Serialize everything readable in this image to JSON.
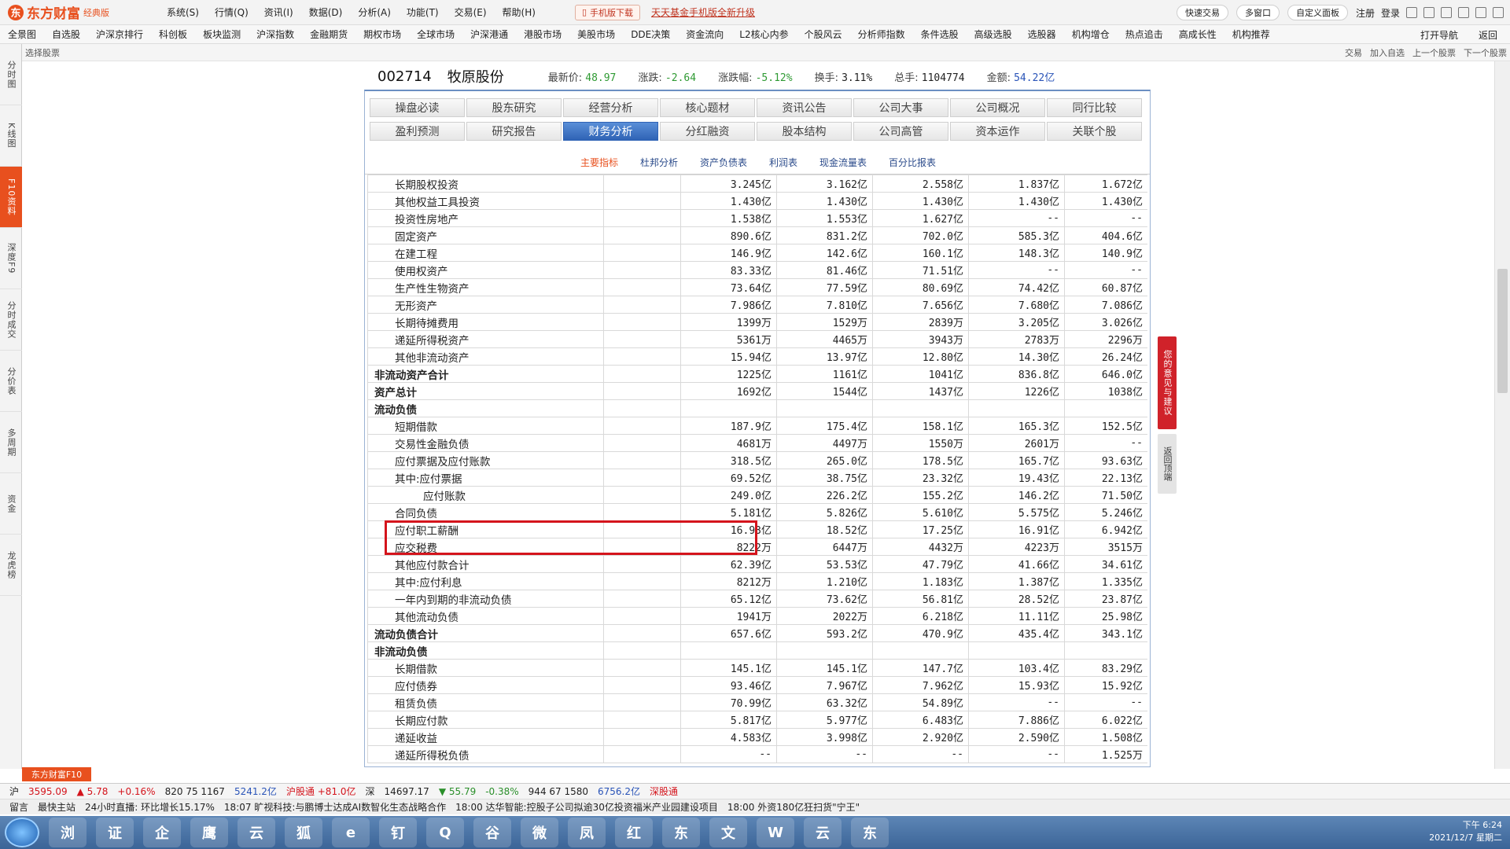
{
  "app": {
    "logo_mark": "东",
    "name": "东方财富",
    "edition": "经典版"
  },
  "menus": [
    "系统(S)",
    "行情(Q)",
    "资讯(I)",
    "数据(D)",
    "分析(A)",
    "功能(T)",
    "交易(E)",
    "帮助(H)"
  ],
  "download_button": "手机版下载",
  "promo_text": "天天基金手机版全新升级",
  "top_tools": {
    "quick_trade": "快速交易",
    "multi_window": "多窗口",
    "custom_panel": "自定义面板",
    "register": "注册",
    "login": "登录"
  },
  "nav_items": [
    "全景图",
    "自选股",
    "沪深京排行",
    "科创板",
    "板块监测",
    "沪深指数",
    "金融期货",
    "期权市场",
    "全球市场",
    "沪深港通",
    "港股市场",
    "美股市场",
    "DDE决策",
    "资金流向",
    "L2核心内参",
    "个股风云",
    "分析师指数",
    "条件选股",
    "高级选股",
    "选股器",
    "机构增仓",
    "热点追击",
    "高成长性",
    "机构推荐"
  ],
  "nav_right": [
    "打开导航",
    "返回"
  ],
  "subbar": {
    "select_stock": "选择股票",
    "actions": [
      "交易",
      "加入自选",
      "上一个股票",
      "下一个股票"
    ]
  },
  "sidebar": [
    {
      "label": "分时图",
      "active": false
    },
    {
      "label": "K线图",
      "active": false
    },
    {
      "label": "F10资料",
      "active": true
    },
    {
      "label": "深度F9",
      "active": false
    },
    {
      "label": "分时成交",
      "active": false
    },
    {
      "label": "分价表",
      "active": false
    },
    {
      "label": "多周期",
      "active": false
    },
    {
      "label": "资金",
      "active": false
    },
    {
      "label": "龙虎榜",
      "active": false
    }
  ],
  "stock": {
    "code": "002714",
    "name": "牧原股份",
    "latest_label": "最新价:",
    "latest": "48.97",
    "change_label": "涨跌:",
    "change": "-2.64",
    "change_pct_label": "涨跌幅:",
    "change_pct": "-5.12%",
    "turnover_label": "换手:",
    "turnover": "3.11%",
    "volume_label": "总手:",
    "volume": "1104774",
    "amount_label": "金额:",
    "amount": "54.22亿"
  },
  "tabs_row1": [
    {
      "label": "操盘必读",
      "active": false
    },
    {
      "label": "股东研究",
      "active": false
    },
    {
      "label": "经营分析",
      "active": false
    },
    {
      "label": "核心题材",
      "active": false
    },
    {
      "label": "资讯公告",
      "active": false
    },
    {
      "label": "公司大事",
      "active": false
    },
    {
      "label": "公司概况",
      "active": false
    },
    {
      "label": "同行比较",
      "active": false
    }
  ],
  "tabs_row2": [
    {
      "label": "盈利预测",
      "active": false
    },
    {
      "label": "研究报告",
      "active": false
    },
    {
      "label": "财务分析",
      "active": true
    },
    {
      "label": "分红融资",
      "active": false
    },
    {
      "label": "股本结构",
      "active": false
    },
    {
      "label": "公司高管",
      "active": false
    },
    {
      "label": "资本运作",
      "active": false
    },
    {
      "label": "关联个股",
      "active": false
    }
  ],
  "subtabs": [
    {
      "label": "主要指标",
      "active": true
    },
    {
      "label": "杜邦分析",
      "active": false
    },
    {
      "label": "资产负债表",
      "active": false
    },
    {
      "label": "利润表",
      "active": false
    },
    {
      "label": "现金流量表",
      "active": false
    },
    {
      "label": "百分比报表",
      "active": false
    }
  ],
  "balance_rows": [
    {
      "label": "长期股权投资",
      "style": "",
      "values": [
        "3.245亿",
        "3.162亿",
        "2.558亿",
        "1.837亿",
        "1.672亿"
      ]
    },
    {
      "label": "其他权益工具投资",
      "style": "",
      "values": [
        "1.430亿",
        "1.430亿",
        "1.430亿",
        "1.430亿",
        "1.430亿"
      ]
    },
    {
      "label": "投资性房地产",
      "style": "",
      "values": [
        "1.538亿",
        "1.553亿",
        "1.627亿",
        "--",
        "--"
      ]
    },
    {
      "label": "固定资产",
      "style": "",
      "values": [
        "890.6亿",
        "831.2亿",
        "702.0亿",
        "585.3亿",
        "404.6亿"
      ]
    },
    {
      "label": "在建工程",
      "style": "",
      "values": [
        "146.9亿",
        "142.6亿",
        "160.1亿",
        "148.3亿",
        "140.9亿"
      ]
    },
    {
      "label": "使用权资产",
      "style": "",
      "values": [
        "83.33亿",
        "81.46亿",
        "71.51亿",
        "--",
        "--"
      ]
    },
    {
      "label": "生产性生物资产",
      "style": "",
      "values": [
        "73.64亿",
        "77.59亿",
        "80.69亿",
        "74.42亿",
        "60.87亿"
      ]
    },
    {
      "label": "无形资产",
      "style": "",
      "values": [
        "7.986亿",
        "7.810亿",
        "7.656亿",
        "7.680亿",
        "7.086亿"
      ]
    },
    {
      "label": "长期待摊费用",
      "style": "",
      "values": [
        "1399万",
        "1529万",
        "2839万",
        "3.205亿",
        "3.026亿"
      ]
    },
    {
      "label": "递延所得税资产",
      "style": "",
      "values": [
        "5361万",
        "4465万",
        "3943万",
        "2783万",
        "2296万"
      ]
    },
    {
      "label": "其他非流动资产",
      "style": "",
      "values": [
        "15.94亿",
        "13.97亿",
        "12.80亿",
        "14.30亿",
        "26.24亿"
      ]
    },
    {
      "label": "非流动资产合计",
      "style": "bold",
      "values": [
        "1225亿",
        "1161亿",
        "1041亿",
        "836.8亿",
        "646.0亿"
      ]
    },
    {
      "label": "资产总计",
      "style": "bold",
      "values": [
        "1692亿",
        "1544亿",
        "1437亿",
        "1226亿",
        "1038亿"
      ]
    },
    {
      "label": "流动负债",
      "style": "bold",
      "values": [
        "",
        "",
        "",
        "",
        ""
      ]
    },
    {
      "label": "短期借款",
      "style": "",
      "values": [
        "187.9亿",
        "175.4亿",
        "158.1亿",
        "165.3亿",
        "152.5亿"
      ]
    },
    {
      "label": "交易性金融负债",
      "style": "",
      "values": [
        "4681万",
        "4497万",
        "1550万",
        "2601万",
        "--"
      ]
    },
    {
      "label": "应付票据及应付账款",
      "style": "",
      "values": [
        "318.5亿",
        "265.0亿",
        "178.5亿",
        "165.7亿",
        "93.63亿"
      ]
    },
    {
      "label": "其中:应付票据",
      "style": "",
      "values": [
        "69.52亿",
        "38.75亿",
        "23.32亿",
        "19.43亿",
        "22.13亿"
      ]
    },
    {
      "label": "应付账款",
      "style": "sub",
      "values": [
        "249.0亿",
        "226.2亿",
        "155.2亿",
        "146.2亿",
        "71.50亿"
      ]
    },
    {
      "label": "合同负债",
      "style": "",
      "values": [
        "5.181亿",
        "5.826亿",
        "5.610亿",
        "5.575亿",
        "5.246亿"
      ]
    },
    {
      "label": "应付职工薪酬",
      "style": "",
      "values": [
        "16.93亿",
        "18.52亿",
        "17.25亿",
        "16.91亿",
        "6.942亿"
      ]
    },
    {
      "label": "应交税费",
      "style": "",
      "values": [
        "8222万",
        "6447万",
        "4432万",
        "4223万",
        "3515万"
      ]
    },
    {
      "label": "其他应付款合计",
      "style": "",
      "values": [
        "62.39亿",
        "53.53亿",
        "47.79亿",
        "41.66亿",
        "34.61亿"
      ]
    },
    {
      "label": "其中:应付利息",
      "style": "",
      "values": [
        "8212万",
        "1.210亿",
        "1.183亿",
        "1.387亿",
        "1.335亿"
      ]
    },
    {
      "label": "一年内到期的非流动负债",
      "style": "",
      "values": [
        "65.12亿",
        "73.62亿",
        "56.81亿",
        "28.52亿",
        "23.87亿"
      ]
    },
    {
      "label": "其他流动负债",
      "style": "",
      "values": [
        "1941万",
        "2022万",
        "6.218亿",
        "11.11亿",
        "25.98亿"
      ]
    },
    {
      "label": "流动负债合计",
      "style": "bold",
      "values": [
        "657.6亿",
        "593.2亿",
        "470.9亿",
        "435.4亿",
        "343.1亿"
      ]
    },
    {
      "label": "非流动负债",
      "style": "bold",
      "values": [
        "",
        "",
        "",
        "",
        ""
      ]
    },
    {
      "label": "长期借款",
      "style": "",
      "values": [
        "145.1亿",
        "145.1亿",
        "147.7亿",
        "103.4亿",
        "83.29亿"
      ]
    },
    {
      "label": "应付债券",
      "style": "",
      "values": [
        "93.46亿",
        "7.967亿",
        "7.962亿",
        "15.93亿",
        "15.92亿"
      ]
    },
    {
      "label": "租赁负债",
      "style": "",
      "values": [
        "70.99亿",
        "63.32亿",
        "54.89亿",
        "--",
        "--"
      ]
    },
    {
      "label": "长期应付款",
      "style": "",
      "values": [
        "5.817亿",
        "5.977亿",
        "6.483亿",
        "7.886亿",
        "6.022亿"
      ]
    },
    {
      "label": "递延收益",
      "style": "",
      "values": [
        "4.583亿",
        "3.998亿",
        "2.920亿",
        "2.590亿",
        "1.508亿"
      ]
    },
    {
      "label": "递延所得税负债",
      "style": "",
      "values": [
        "--",
        "--",
        "--",
        "--",
        "1.525万"
      ]
    }
  ],
  "feedback": "您的意见与建议",
  "back_to_top": "返回顶端",
  "f10_badge": "东方财富F10",
  "ticker": [
    {
      "text": "沪",
      "cls": ""
    },
    {
      "text": "3595.09",
      "cls": "r"
    },
    {
      "text": "▲ 5.78",
      "cls": "r"
    },
    {
      "text": "+0.16%",
      "cls": "r"
    },
    {
      "text": "820 75 1167",
      "cls": ""
    },
    {
      "text": "5241.2亿",
      "cls": "bl"
    },
    {
      "text": "沪股通 +81.0亿",
      "cls": "r"
    },
    {
      "text": "深",
      "cls": ""
    },
    {
      "text": "14697.17",
      "cls": ""
    },
    {
      "text": "▼ 55.79",
      "cls": "gr"
    },
    {
      "text": "-0.38%",
      "cls": "gr"
    },
    {
      "text": "944 67 1580",
      "cls": ""
    },
    {
      "text": "6756.2亿",
      "cls": "bl"
    },
    {
      "text": "深股通",
      "cls": "r"
    }
  ],
  "news": [
    "留言",
    "最快主站",
    "24小时直播: 环比增长15.17%",
    "18:07 旷视科技:与鹏博士达成AI数智化生态战略合作",
    "18:00 达华智能:控股子公司拟逾30亿投资福米产业园建设项目",
    "18:00 外资180亿狂扫货\"宁王\""
  ],
  "taskbar_icons": [
    "浏",
    "证",
    "企",
    "鹰",
    "云",
    "狐",
    "e",
    "钉",
    "Q",
    "谷",
    "微",
    "凤",
    "红",
    "东",
    "文",
    "W",
    "云",
    "东"
  ],
  "clock": {
    "time": "下午 6:24",
    "date": "2021/12/7 星期二"
  }
}
